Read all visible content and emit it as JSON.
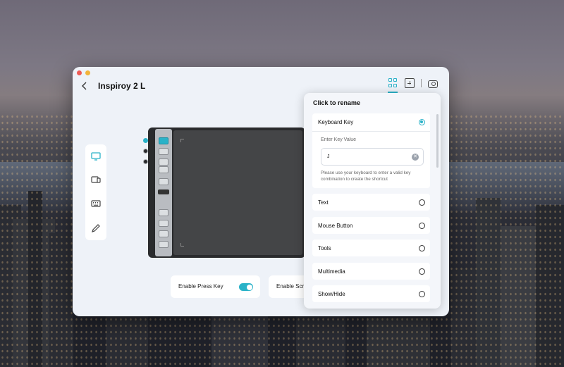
{
  "window": {
    "title": "Inspiroy 2 L",
    "back_icon": "chevron-left-icon",
    "toolbar_icons": [
      "grid-icon",
      "add-icon",
      "camera-icon"
    ]
  },
  "sidebar": {
    "items": [
      {
        "icon": "monitor-icon",
        "active": true
      },
      {
        "icon": "devices-icon",
        "active": false
      },
      {
        "icon": "keyboard-icon",
        "active": false
      },
      {
        "icon": "pen-icon",
        "active": false
      }
    ]
  },
  "bottom": {
    "enable_press_key_label": "Enable Press Key",
    "enable_scroll_label": "Enable Scr"
  },
  "popover": {
    "title": "Click to rename",
    "keyboard_key": {
      "label": "Keyboard Key",
      "caption": "Enter Key Value",
      "value": "J",
      "help": "Please use your keyboard to enter a valid key combination to create the shortcut"
    },
    "options": [
      {
        "label": "Text"
      },
      {
        "label": "Mouse Button"
      },
      {
        "label": "Tools"
      },
      {
        "label": "Multimedia"
      },
      {
        "label": "Show/Hide"
      }
    ]
  },
  "colors": {
    "accent": "#2ab2c8",
    "window_bg": "#eef2f8",
    "tablet_body": "#2a2b2d"
  }
}
